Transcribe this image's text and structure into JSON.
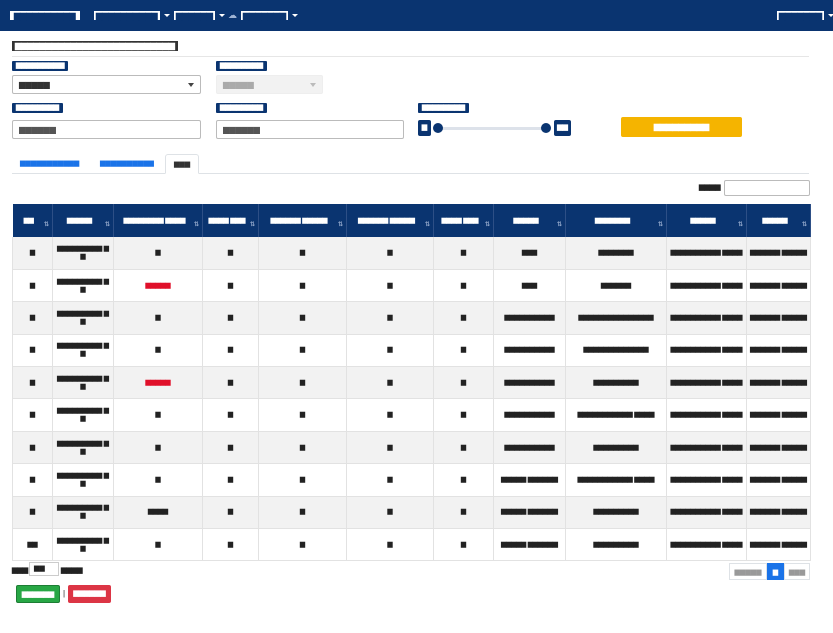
{
  "navbar": {
    "brand": "▆▆▆▆▆▆▆▆▆▆",
    "menu_1": "▆▆▆▆▆▆▆▆▆▆",
    "menu_2": "▆▆▆▆▆▆",
    "menu_3": "▆▆▆▆▆▆▆",
    "user": "▆▆▆▆▆▆▆"
  },
  "page": {
    "title": "▆▆▆▆▆▆▆▆▆▆▆▆▆▆▆▆▆▆▆▆▆▆▆▆▆▆"
  },
  "filters": {
    "label_1": "▆▆▆▆▆▆▆▆▆",
    "select_1": "▆▆▆▆▆",
    "label_2": "▆▆▆▆▆▆▆▆",
    "select_2": "▆▆▆▆▆",
    "label_3": "▆▆▆▆▆▆▆▆",
    "input_3_placeholder": "▆▆▆▆▆▆",
    "label_4": "▆▆▆▆▆▆▆▆",
    "input_4_placeholder": "▆▆▆▆▆▆",
    "label_5": "▆▆▆▆▆▆▆▆",
    "slider_min": "▆",
    "slider_max": "▆▆",
    "search_button": "▆▆▆▆▆▆▆▆▆"
  },
  "tabs": [
    {
      "label": "▆▆▆▆▆▆▆▆▆▆▆"
    },
    {
      "label": "▆▆▆▆▆▆▆▆▆▆"
    },
    {
      "label": "▆▆▆"
    }
  ],
  "table_search_label": "▆▆▆▆",
  "table": {
    "headers": [
      "▆▆",
      "▆▆▆▆▆",
      "▆▆▆▆▆▆▆▆ ▆▆▆▆",
      "▆▆▆▆ ▆▆▆",
      "▆▆▆▆▆▆ ▆▆▆▆▆",
      "▆▆▆▆▆▆ ▆▆▆▆▆",
      "▆▆▆▆ ▆▆▆",
      "▆▆▆▆▆",
      "▆▆▆▆▆▆▆",
      "▆▆▆▆▆",
      "▆▆▆▆▆"
    ],
    "rows": [
      [
        "▆",
        "▆▆▆▆▆▆▆▆▆ ▆▆",
        "▆",
        "▆",
        "▆",
        "▆",
        "▆",
        "▆▆▆",
        "▆▆▆▆▆▆▆",
        "▆▆▆▆▆▆▆▆▆▆ ▆▆▆▆",
        "▆▆▆▆▆▆ ▆▆▆▆▆"
      ],
      [
        "▆",
        "▆▆▆▆▆▆▆▆▆ ▆▆",
        "▆▆▆▆▆",
        "▆",
        "▆",
        "▆",
        "▆",
        "▆▆▆",
        "▆▆▆▆▆▆",
        "▆▆▆▆▆▆▆▆▆▆ ▆▆▆▆",
        "▆▆▆▆▆▆ ▆▆▆▆▆"
      ],
      [
        "▆",
        "▆▆▆▆▆▆▆▆▆ ▆▆",
        "▆",
        "▆",
        "▆",
        "▆",
        "▆",
        "▆▆▆▆▆▆▆▆▆▆",
        "▆▆▆▆▆▆▆▆▆▆▆▆▆▆▆",
        "▆▆▆▆▆▆▆▆▆▆ ▆▆▆▆",
        "▆▆▆▆▆▆ ▆▆▆▆▆"
      ],
      [
        "▆",
        "▆▆▆▆▆▆▆▆▆ ▆▆",
        "▆",
        "▆",
        "▆",
        "▆",
        "▆",
        "▆▆▆▆▆▆▆▆▆▆",
        "▆▆▆▆▆▆▆▆▆▆▆▆▆",
        "▆▆▆▆▆▆▆▆▆▆ ▆▆▆▆",
        "▆▆▆▆▆▆ ▆▆▆▆▆"
      ],
      [
        "▆",
        "▆▆▆▆▆▆▆▆▆ ▆▆",
        "▆▆▆▆▆",
        "▆",
        "▆",
        "▆",
        "▆",
        "▆▆▆▆▆▆▆▆▆▆",
        "▆▆▆▆▆▆▆▆▆",
        "▆▆▆▆▆▆▆▆▆▆ ▆▆▆▆",
        "▆▆▆▆▆▆ ▆▆▆▆▆"
      ],
      [
        "▆",
        "▆▆▆▆▆▆▆▆▆ ▆▆",
        "▆",
        "▆",
        "▆",
        "▆",
        "▆",
        "▆▆▆▆▆▆▆▆▆▆",
        "▆▆▆▆▆▆▆▆▆▆▆ ▆▆▆▆",
        "▆▆▆▆▆▆▆▆▆▆ ▆▆▆▆",
        "▆▆▆▆▆▆ ▆▆▆▆▆"
      ],
      [
        "▆",
        "▆▆▆▆▆▆▆▆▆ ▆▆",
        "▆",
        "▆",
        "▆",
        "▆",
        "▆",
        "▆▆▆▆▆▆▆▆▆▆",
        "▆▆▆▆▆▆▆▆▆",
        "▆▆▆▆▆▆▆▆▆▆ ▆▆▆▆",
        "▆▆▆▆▆▆ ▆▆▆▆▆"
      ],
      [
        "▆",
        "▆▆▆▆▆▆▆▆▆ ▆▆",
        "▆",
        "▆",
        "▆",
        "▆",
        "▆",
        "▆▆▆▆▆ ▆▆▆▆▆▆",
        "▆▆▆▆▆▆▆▆▆▆▆ ▆▆▆▆",
        "▆▆▆▆▆▆▆▆▆▆ ▆▆▆▆",
        "▆▆▆▆▆▆ ▆▆▆▆▆"
      ],
      [
        "▆",
        "▆▆▆▆▆▆▆▆▆ ▆▆",
        "▆▆▆▆",
        "▆",
        "▆",
        "▆",
        "▆",
        "▆▆▆▆▆ ▆▆▆▆▆▆",
        "▆▆▆▆▆▆▆▆▆",
        "▆▆▆▆▆▆▆▆▆▆ ▆▆▆▆",
        "▆▆▆▆▆▆ ▆▆▆▆▆"
      ],
      [
        "▆▆",
        "▆▆▆▆▆▆▆▆▆ ▆▆",
        "▆",
        "▆",
        "▆",
        "▆",
        "▆",
        "▆▆▆▆▆ ▆▆▆▆▆▆",
        "▆▆▆▆▆▆▆▆▆",
        "▆▆▆▆▆▆▆▆▆▆ ▆▆▆▆",
        "▆▆▆▆▆▆ ▆▆▆▆▆"
      ]
    ],
    "red_cells": [
      [
        1,
        2
      ],
      [
        4,
        2
      ]
    ]
  },
  "footer": {
    "show_label": "▆▆▆",
    "show_value": "▆▆",
    "entries_label": "▆▆▆▆",
    "prev_label": "▆▆▆▆▆",
    "page_label": "▆",
    "next_label": "▆▆▆",
    "export_button": "▆▆▆▆▆▆",
    "separator": "|",
    "reset_button": "▆▆▆▆▆▆"
  },
  "colors": {
    "navbar": "#0a3470",
    "accent_button": "#f5b400",
    "link": "#1a73e8",
    "alert_red": "#e0102a",
    "green_button": "#28a745",
    "red_button": "#dc3545"
  }
}
